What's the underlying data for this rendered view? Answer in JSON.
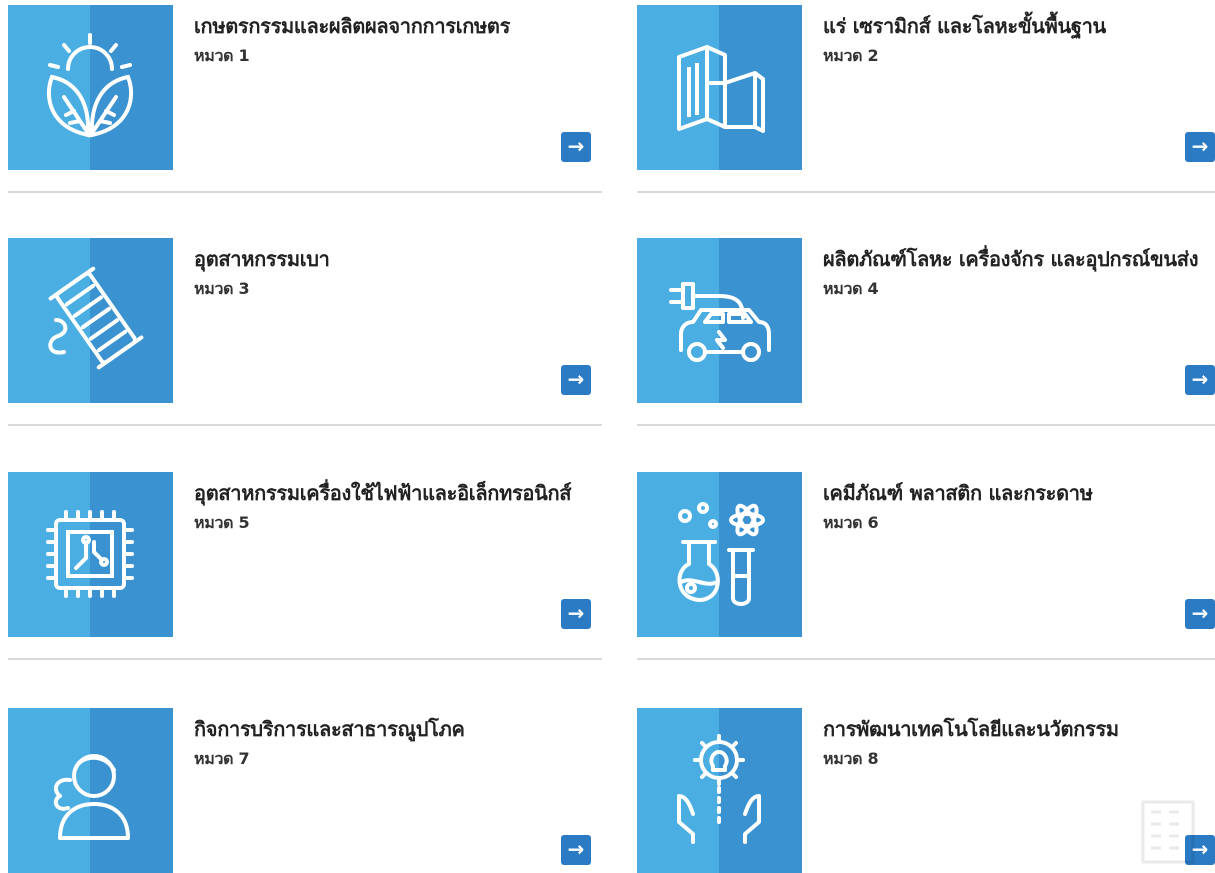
{
  "categories": [
    {
      "title": "เกษตรกรรมและผลิตผลจากการเกษตร",
      "sub": "หมวด 1",
      "icon": "leaves-sun-icon"
    },
    {
      "title": "แร่ เซรามิกส์ และโลหะขั้นพื้นฐาน",
      "sub": "หมวด 2",
      "icon": "steel-beam-icon"
    },
    {
      "title": "อุตสาหกรรมเบา",
      "sub": "หมวด 3",
      "icon": "thread-spool-icon"
    },
    {
      "title": "ผลิตภัณฑ์โลหะ เครื่องจักร และอุปกรณ์ขนส่ง",
      "sub": "หมวด 4",
      "icon": "electric-car-icon"
    },
    {
      "title": "อุตสาหกรรมเครื่องใช้ไฟฟ้าและอิเล็กทรอนิกส์",
      "sub": "หมวด 5",
      "icon": "microchip-icon"
    },
    {
      "title": "เคมีภัณฑ์ พลาสติก และกระดาษ",
      "sub": "หมวด 6",
      "icon": "chemistry-flask-icon"
    },
    {
      "title": "กิจการบริการและสาธารณูปโภค",
      "sub": "หมวด 7",
      "icon": "service-person-icon"
    },
    {
      "title": "การพัฒนาเทคโนโลยีและนวัตกรรม",
      "sub": "หมวด 8",
      "icon": "innovation-bulb-icon"
    }
  ],
  "arrow_glyph": "→",
  "colors": {
    "icon_light": "#4aaee2",
    "icon_dark": "#3a92d0",
    "button": "#2b7ac4"
  }
}
